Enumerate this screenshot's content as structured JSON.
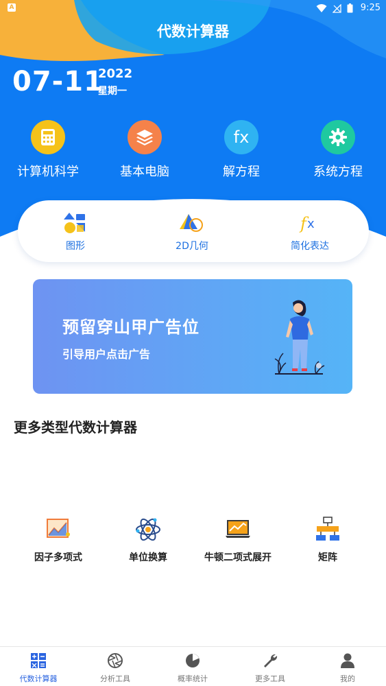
{
  "status_bar": {
    "time": "9:25",
    "app_indicator": "A"
  },
  "app_title": "代数计算器",
  "date": {
    "month_day": "07-11",
    "year": "2022",
    "weekday": "星期一"
  },
  "quick_tools": [
    {
      "label": "计算机科学",
      "icon": "calculator-icon",
      "color": "#f5c21a"
    },
    {
      "label": "基本电脑",
      "icon": "layers-icon",
      "color": "#f5824a"
    },
    {
      "label": "解方程",
      "icon": "fx-icon",
      "color": "#2fb3f2"
    },
    {
      "label": "系统方程",
      "icon": "gear-icon",
      "color": "#1fc9a0"
    }
  ],
  "sub_tools": [
    {
      "label": "图形",
      "icon": "shapes-icon"
    },
    {
      "label": "2D几何",
      "icon": "triangle-circle-icon"
    },
    {
      "label": "简化表达",
      "icon": "fx-icon"
    }
  ],
  "banner": {
    "title": "预留穿山甲广告位",
    "subtitle": "引导用户点击广告"
  },
  "section_title": "更多类型代数计算器",
  "more_tools": [
    {
      "label": "因子多项式",
      "icon": "chart-frame-icon"
    },
    {
      "label": "单位换算",
      "icon": "atom-icon"
    },
    {
      "label": "牛顿二项式展开",
      "icon": "laptop-chart-icon"
    },
    {
      "label": "矩阵",
      "icon": "hierarchy-icon"
    }
  ],
  "bottom_nav": [
    {
      "label": "代数计算器",
      "icon": "calc-grid-icon",
      "active": true
    },
    {
      "label": "分析工具",
      "icon": "aperture-icon",
      "active": false
    },
    {
      "label": "概率统计",
      "icon": "pie-icon",
      "active": false
    },
    {
      "label": "更多工具",
      "icon": "wrench-icon",
      "active": false
    },
    {
      "label": "我的",
      "icon": "user-icon",
      "active": false
    }
  ],
  "colors": {
    "header_blue": "#0e7bf3",
    "accent_blue": "#2a64e0",
    "header_yellow": "#f7b13a"
  }
}
